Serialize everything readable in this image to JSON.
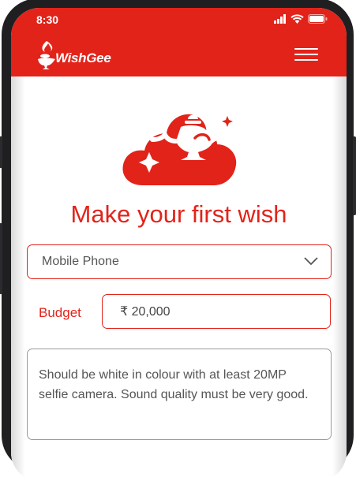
{
  "status": {
    "time": "8:30"
  },
  "app": {
    "name": "WishGee",
    "brand_color": "#e2231a"
  },
  "icons": {
    "menu": "hamburger-menu-icon",
    "hero": "magic-lamp-cloud-icon",
    "dropdown": "chevron-down-icon"
  },
  "page": {
    "title": "Make your first wish"
  },
  "form": {
    "category": {
      "selected": "Mobile Phone"
    },
    "budget": {
      "label": "Budget",
      "value": "₹ 20,000"
    },
    "description": {
      "value": "Should be white in colour with at least 20MP selfie camera. Sound quality must be very good."
    }
  }
}
